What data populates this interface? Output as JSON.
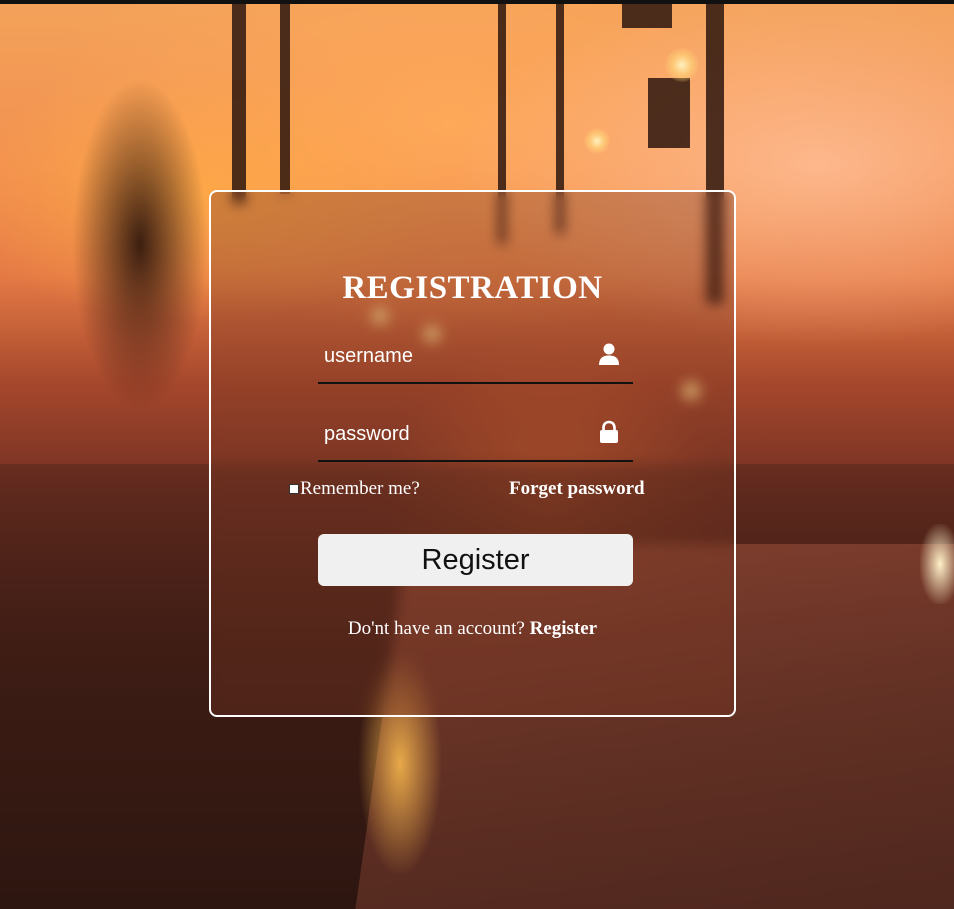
{
  "form": {
    "title": "REGISTRATION",
    "username_placeholder": "username",
    "password_placeholder": "password",
    "remember_label": "Remember me?",
    "remember_checked": false,
    "forget_label": "Forget password",
    "submit_label": "Register",
    "signup_prompt": "Do'nt have an account?",
    "signup_link": "Register"
  },
  "icons": {
    "username": "user-icon",
    "password": "lock-icon"
  },
  "colors": {
    "text": "#ffffff",
    "button_bg": "#f0f0f0",
    "button_text": "#111111",
    "card_border": "#ffffff"
  }
}
